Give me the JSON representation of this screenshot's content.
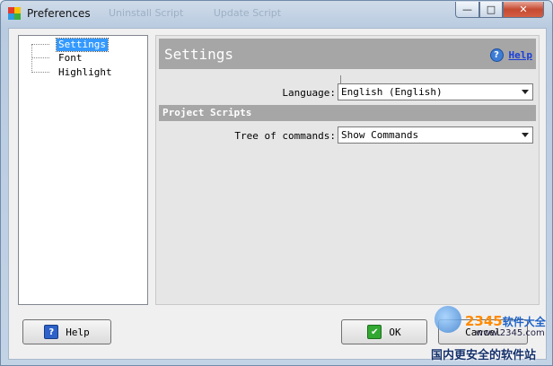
{
  "window": {
    "title": "Preferences",
    "background_tabs": [
      "Uninstall Script",
      "Update Script"
    ],
    "controls": {
      "minimize": "—",
      "maximize": "□",
      "close": "✕"
    }
  },
  "tree": {
    "items": [
      {
        "label": "Settings",
        "selected": true
      },
      {
        "label": "Font",
        "selected": false
      },
      {
        "label": "Highlight",
        "selected": false
      }
    ]
  },
  "panel": {
    "title": "Settings",
    "help_link": "Help",
    "language": {
      "label": "Language:",
      "value": "English (English)"
    },
    "section": "Project Scripts",
    "tree_of_commands": {
      "label": "Tree of commands:",
      "value": "Show Commands"
    }
  },
  "buttons": {
    "help": "Help",
    "ok": "OK",
    "cancel": "Cancel"
  },
  "watermark": {
    "brand_prefix": "2345",
    "brand_suffix": "软件大全",
    "url": "www.2345.com",
    "slogan": "国内更安全的软件站"
  },
  "colors": {
    "header_gray": "#a6a6a6",
    "selection_blue": "#3399ff",
    "link_blue": "#1a3fd8",
    "close_red": "#c54a31"
  }
}
